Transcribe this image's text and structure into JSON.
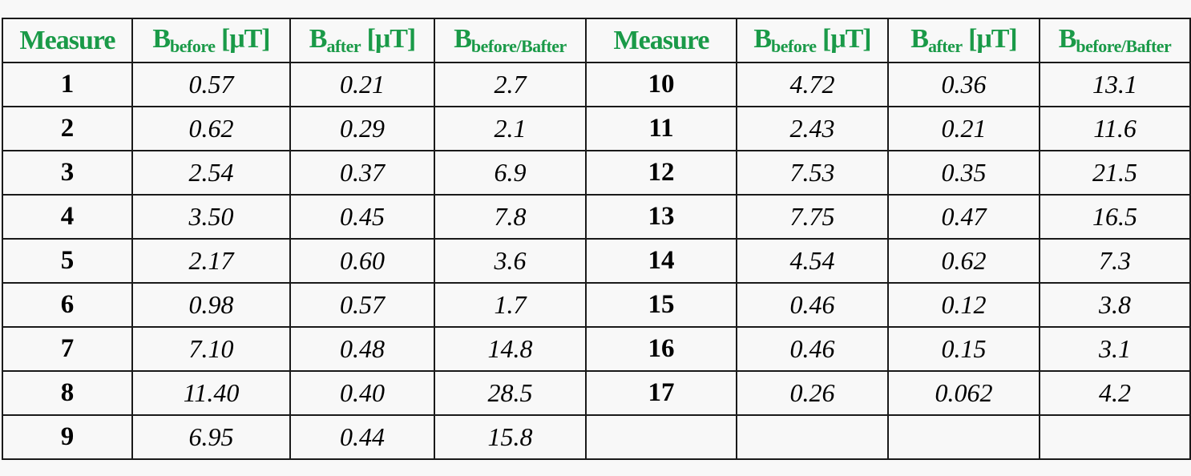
{
  "table": {
    "headers": [
      {
        "main": "Measure",
        "sub": "",
        "unit": ""
      },
      {
        "main": "B",
        "sub": "before",
        "unit": " [μT]"
      },
      {
        "main": "B",
        "sub": "after",
        "unit": " [μT]"
      },
      {
        "main": "B",
        "sub": "before/Bafter",
        "unit": ""
      },
      {
        "main": "Measure",
        "sub": "",
        "unit": ""
      },
      {
        "main": "B",
        "sub": "before",
        "unit": " [μT]"
      },
      {
        "main": "B",
        "sub": "after",
        "unit": " [μT]"
      },
      {
        "main": "B",
        "sub": "before/Bafter",
        "unit": ""
      }
    ],
    "header_color": "#1a9a48",
    "rows": [
      [
        "1",
        "0.57",
        "0.21",
        "2.7",
        "10",
        "4.72",
        "0.36",
        "13.1"
      ],
      [
        "2",
        "0.62",
        "0.29",
        "2.1",
        "11",
        "2.43",
        "0.21",
        "11.6"
      ],
      [
        "3",
        "2.54",
        "0.37",
        "6.9",
        "12",
        "7.53",
        "0.35",
        "21.5"
      ],
      [
        "4",
        "3.50",
        "0.45",
        "7.8",
        "13",
        "7.75",
        "0.47",
        "16.5"
      ],
      [
        "5",
        "2.17",
        "0.60",
        "3.6",
        "14",
        "4.54",
        "0.62",
        "7.3"
      ],
      [
        "6",
        "0.98",
        "0.57",
        "1.7",
        "15",
        "0.46",
        "0.12",
        "3.8"
      ],
      [
        "7",
        "7.10",
        "0.48",
        "14.8",
        "16",
        "0.46",
        "0.15",
        "3.1"
      ],
      [
        "8",
        "11.40",
        "0.40",
        "28.5",
        "17",
        "0.26",
        "0.062",
        "4.2"
      ],
      [
        "9",
        "6.95",
        "0.44",
        "15.8",
        "",
        "",
        "",
        ""
      ]
    ]
  }
}
